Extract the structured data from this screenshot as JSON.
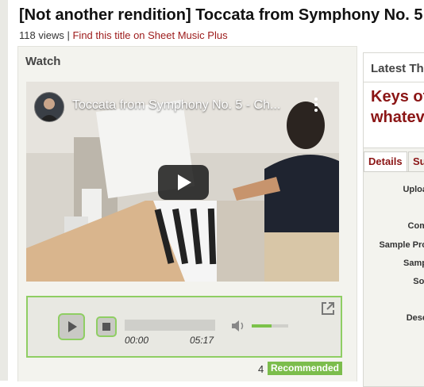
{
  "page": {
    "title": "[Not another rendition] Toccata from Symphony No. 5",
    "views": "118 views",
    "separator": "|",
    "sheet_music_link": "Find this title on Sheet Music Plus"
  },
  "watch": {
    "heading": "Watch",
    "video": {
      "title": "Toccata from Symphony No. 5 - Ch...",
      "icons": [
        "channel-avatar",
        "more-vert-icon",
        "play-icon"
      ]
    }
  },
  "audio_player": {
    "current_time": "00:00",
    "duration": "05:17",
    "progress": 0.0,
    "volume": 0.55,
    "icons": [
      "play-icon",
      "stop-icon",
      "volume-icon",
      "popout-icon"
    ]
  },
  "recommendation": {
    "count": "4",
    "label": "Recommended",
    "color": "#7cbd4c"
  },
  "sidebar": {
    "latest_heading": "Latest Th",
    "headline_lines": [
      "Keys of",
      "whatev"
    ],
    "tabs": [
      {
        "label": "Details",
        "active": true
      },
      {
        "label": "Su",
        "active": false
      }
    ],
    "detail_labels": [
      "Uploa",
      "Com",
      "Sample Pro",
      "Samp",
      "Sof",
      "",
      "Desc"
    ]
  },
  "colors": {
    "accent_red": "#9c1a1a",
    "accent_green": "#8fce63"
  }
}
